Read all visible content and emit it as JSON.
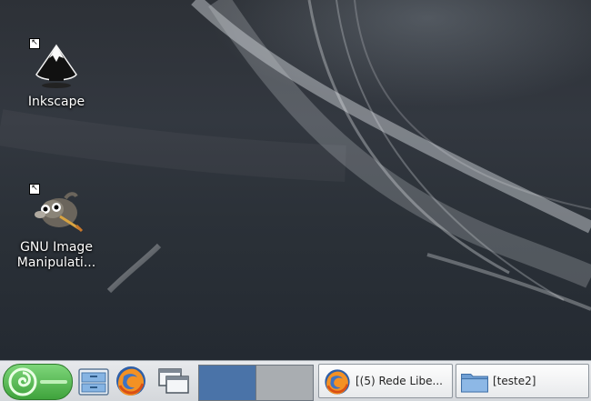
{
  "desktop": {
    "icons": [
      {
        "label": "Inkscape",
        "icon": "inkscape-icon"
      },
      {
        "label": "GNU Image Manipulati...",
        "icon": "gimp-icon"
      }
    ]
  },
  "taskbar": {
    "menu_icon": "opensuse-gecko-icon",
    "launchers": [
      {
        "icon": "file-manager-icon"
      },
      {
        "icon": "firefox-icon"
      },
      {
        "icon": "show-desktop-icon"
      }
    ],
    "pager": {
      "desktops": [
        {
          "state": "active"
        },
        {
          "state": "inactive"
        }
      ]
    },
    "tasks": [
      {
        "label": "[(5) Rede Libe...",
        "icon": "firefox-icon"
      },
      {
        "label": "[teste2]",
        "icon": "folder-icon"
      }
    ]
  },
  "colors": {
    "pager_active": "#4a73a8",
    "pager_inactive": "#a9adb1",
    "menu_green": "#3fa33c"
  }
}
